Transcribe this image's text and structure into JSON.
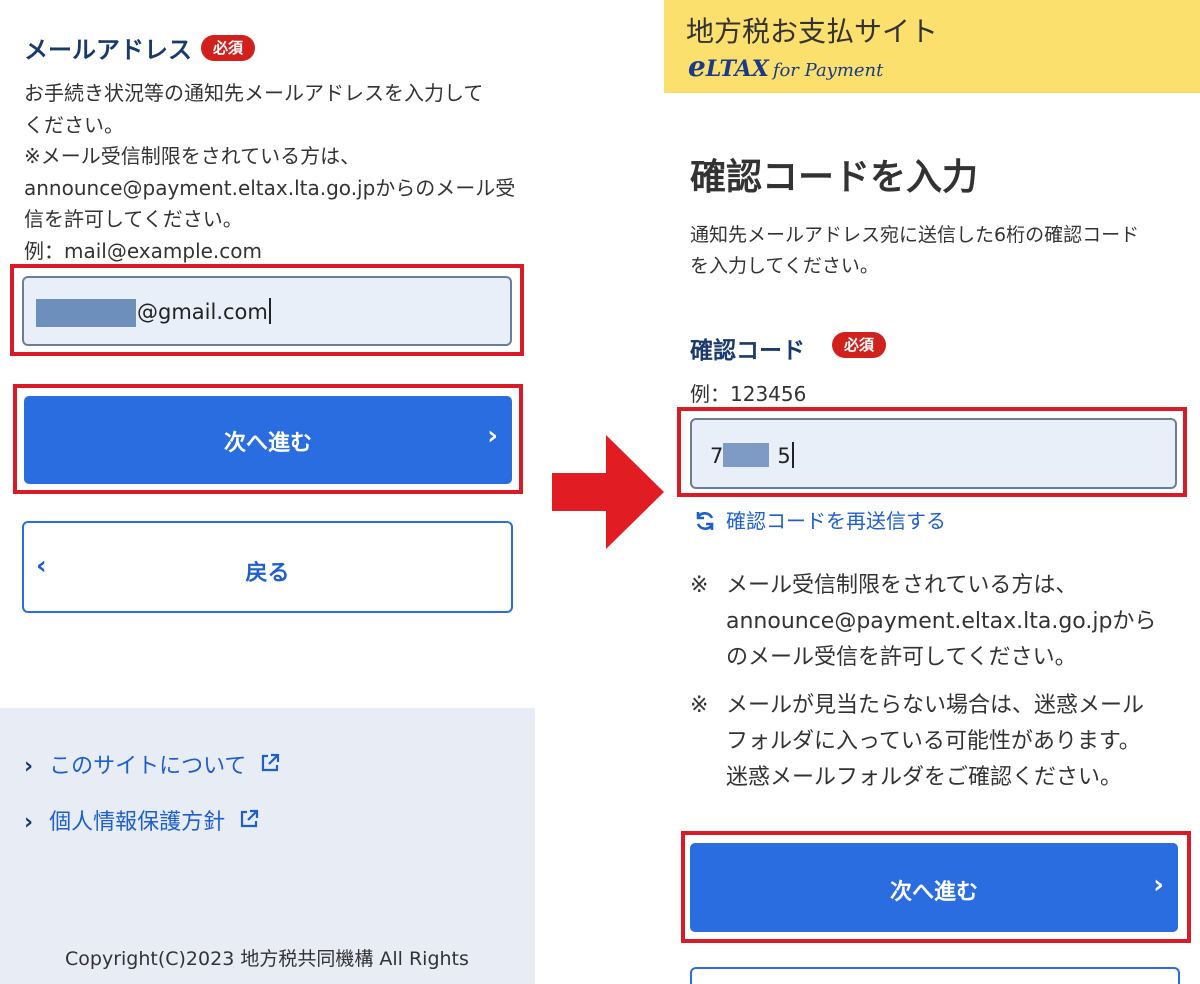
{
  "left": {
    "email_label": "メールアドレス",
    "required_badge": "必須",
    "description_lines": [
      "お手続き状況等の通知先メールアドレスを入力して",
      "ください。",
      "※メール受信制限をされている方は、",
      "announce@payment.eltax.lta.go.jpからのメール受",
      "信を許可してください。",
      "例：mail@example.com"
    ],
    "email_input_value": "@gmail.com",
    "next_button": "次へ進む",
    "back_button": "戻る",
    "footer_links": [
      "このサイトについて",
      "個人情報保護方針"
    ],
    "copyright": "Copyright(C)2023 地方税共同機構 All Rights"
  },
  "right": {
    "site_title": "地方税お支払サイト",
    "logo": {
      "e": "e",
      "tax": "LTAX",
      "for": "for Payment"
    },
    "page_title": "確認コードを入力",
    "description_lines": [
      "通知先メールアドレス宛に送信した6桁の確認コード",
      "を入力してください。"
    ],
    "code_label": "確認コード",
    "required_badge": "必須",
    "code_example": "例：123456",
    "code_input_start": "7",
    "code_input_end": "5",
    "resend_link": "確認コードを再送信する",
    "notes": [
      {
        "mark": "※",
        "lines": [
          "メール受信制限をされている方は、",
          "announce@payment.eltax.lta.go.jpから",
          "のメール受信を許可してください。"
        ]
      },
      {
        "mark": "※",
        "lines": [
          "メールが見当たらない場合は、迷惑メール",
          "フォルダに入っている可能性があります。",
          "迷惑メールフォルダをご確認ください。"
        ]
      }
    ],
    "next_button": "次へ進む"
  },
  "colors": {
    "primary": "#2a6de1",
    "highlight_frame": "#d81b26",
    "required_badge": "#d0211c",
    "header_yellow": "#fbe06d",
    "footer_bg": "#e8edf5",
    "label_navy": "#1a3a6e"
  },
  "icons": {
    "next_chevron": "chevron-right-icon",
    "back_chevron": "chevron-left-icon",
    "external_link": "external-link-icon",
    "resend": "refresh-icon",
    "flow": "arrow-right-icon"
  }
}
